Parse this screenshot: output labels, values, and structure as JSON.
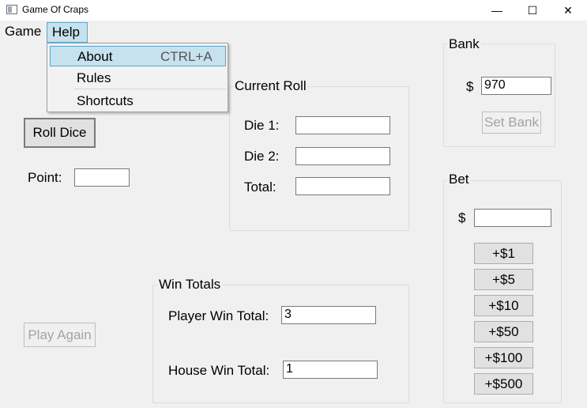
{
  "window": {
    "title": "Game Of Craps",
    "minimize_glyph": "—",
    "maximize_glyph": "☐",
    "close_glyph": "✕"
  },
  "menu": {
    "game_label": "Game",
    "help_label": "Help",
    "help_items": [
      {
        "label": "About",
        "shortcut": "CTRL+A"
      },
      {
        "label": "Rules",
        "shortcut": ""
      },
      {
        "label": "Shortcuts",
        "shortcut": ""
      }
    ]
  },
  "controls": {
    "roll_dice_label": "Roll Dice",
    "point_label": "Point:",
    "point_value": "",
    "play_again_label": "Play Again"
  },
  "current_roll": {
    "title": "Current Roll",
    "die1_label": "Die 1:",
    "die1_value": "",
    "die2_label": "Die 2:",
    "die2_value": "",
    "total_label": "Total:",
    "total_value": ""
  },
  "win_totals": {
    "title": "Win Totals",
    "player_label": "Player Win Total:",
    "player_value": "3",
    "house_label": "House Win Total:",
    "house_value": "1"
  },
  "bank": {
    "title": "Bank",
    "currency": "$",
    "value": "970",
    "set_bank_label": "Set Bank"
  },
  "bet": {
    "title": "Bet",
    "currency": "$",
    "value": "",
    "buttons": [
      "+$1",
      "+$5",
      "+$10",
      "+$50",
      "+$100",
      "+$500"
    ]
  }
}
